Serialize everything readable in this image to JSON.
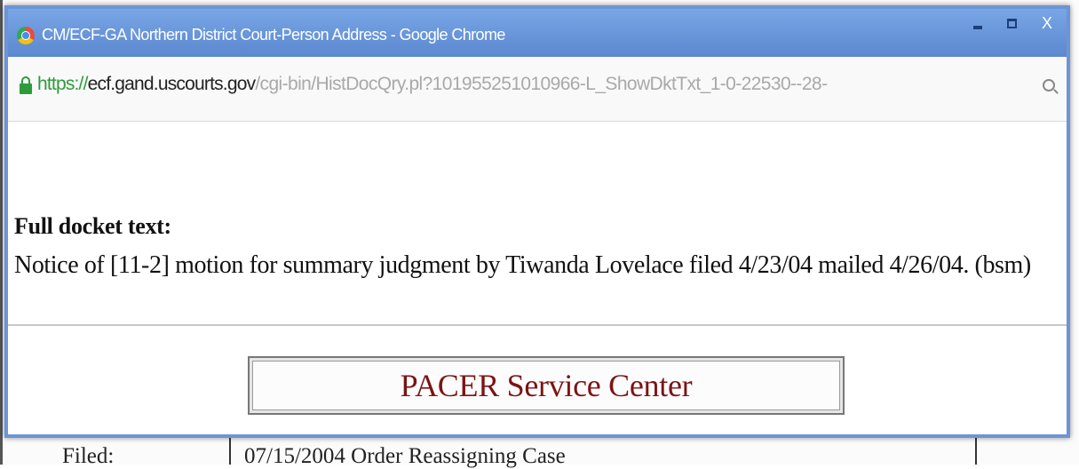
{
  "window": {
    "title": "CM/ECF-GA Northern District Court-Person Address - Google Chrome",
    "controls": {
      "minimize_icon": "minimize-icon",
      "maximize_icon": "maximize-icon",
      "close_label": "X"
    }
  },
  "address_bar": {
    "url_scheme": "https://",
    "url_host": "ecf.gand.uscourts.gov",
    "url_path": "/cgi-bin/HistDocQry.pl?101955251010966-L_ShowDktTxt_1-0-22530--28-",
    "icons": [
      "lock-icon",
      "zoom-icon"
    ]
  },
  "docket": {
    "label": "Full docket text:",
    "text": "Notice of [11-2] motion for summary judgment by Tiwanda Lovelace filed 4/23/04 mailed 4/26/04. (bsm)"
  },
  "pacer": {
    "label": "PACER Service Center"
  },
  "background_page": {
    "filed_label": "Filed:",
    "filed_value": "07/15/2004 Order Reassigning Case"
  },
  "colors": {
    "titlebar": "#5b88cf",
    "url_scheme": "#2e9b3a",
    "pacer_text": "#7b1416"
  }
}
